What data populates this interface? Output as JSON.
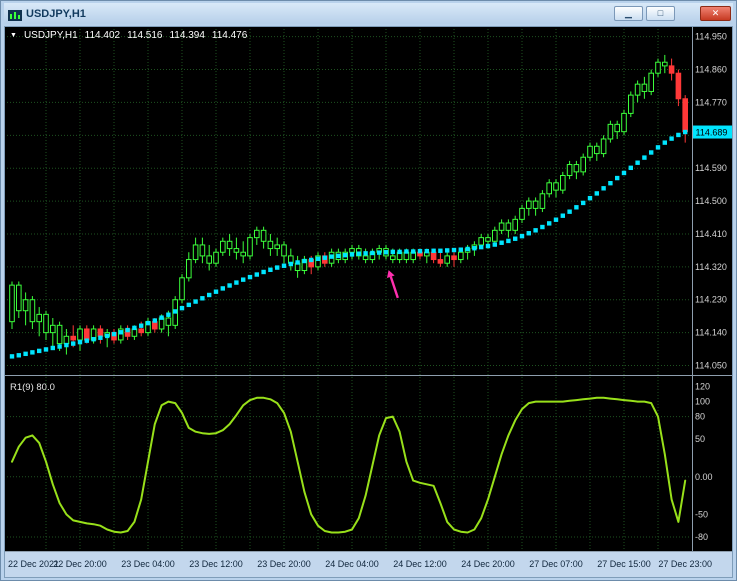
{
  "window": {
    "title": "USDJPY,H1"
  },
  "icons": {
    "dropdown": "▼",
    "minimize": "▁",
    "maximize": "□",
    "close": "✕"
  },
  "header": {
    "symbol_period": "USDJPY,H1",
    "open": "114.402",
    "high": "114.516",
    "low": "114.394",
    "close": "114.476"
  },
  "indicator": {
    "label": "R1(9) 80.0"
  },
  "colors": {
    "chart_bg": "#000000",
    "grid": "#1e5220",
    "candle_up": "#3bff3b",
    "candle_down": "#ff3838",
    "trend": "#00e5ff",
    "oscillator": "#98e01a",
    "separator": "#8e9eae",
    "axis_text": "#d4d4d4",
    "tag_bg": "#00e5ff",
    "tag_text": "#000000",
    "time_strip_bg": "#c3d7ed",
    "time_text": "#10263c",
    "arrow": "#ff2fae"
  },
  "chart_data": {
    "type": "candlestick",
    "title": "USDJPY H1",
    "price_axis": {
      "min": 114.035,
      "max": 114.96,
      "tick_step": 0.09,
      "labels": [
        "114.950",
        "114.860",
        "114.770",
        "114.680",
        "114.590",
        "114.500",
        "114.410",
        "114.320",
        "114.230",
        "114.140",
        "114.050"
      ],
      "current_price": 114.689,
      "current_price_label": "114.689"
    },
    "time_axis": {
      "labels": [
        "22 Dec 2021",
        "22 Dec 20:00",
        "23 Dec 04:00",
        "23 Dec 12:00",
        "23 Dec 20:00",
        "24 Dec 04:00",
        "24 Dec 12:00",
        "24 Dec 20:00",
        "27 Dec 07:00",
        "27 Dec 15:00",
        "27 Dec 23:00"
      ],
      "bar_indices": [
        0,
        10,
        20,
        30,
        40,
        50,
        60,
        70,
        80,
        90,
        99
      ]
    },
    "grid_v_every_bars": 5,
    "candles": [
      [
        114.17,
        114.28,
        114.15,
        114.27,
        "g"
      ],
      [
        114.27,
        114.28,
        114.18,
        114.2,
        "g"
      ],
      [
        114.2,
        114.25,
        114.16,
        114.23,
        "g"
      ],
      [
        114.23,
        114.24,
        114.15,
        114.17,
        "g"
      ],
      [
        114.17,
        114.21,
        114.13,
        114.19,
        "g"
      ],
      [
        114.19,
        114.2,
        114.12,
        114.14,
        "g"
      ],
      [
        114.14,
        114.18,
        114.1,
        114.16,
        "g"
      ],
      [
        114.16,
        114.17,
        114.09,
        114.11,
        "g"
      ],
      [
        114.11,
        114.15,
        114.08,
        114.13,
        "g"
      ],
      [
        114.13,
        114.16,
        114.1,
        114.12,
        "r"
      ],
      [
        114.12,
        114.16,
        114.09,
        114.15,
        "g"
      ],
      [
        114.15,
        114.16,
        114.11,
        114.12,
        "r"
      ],
      [
        114.12,
        114.16,
        114.11,
        114.15,
        "g"
      ],
      [
        114.15,
        114.16,
        114.11,
        114.13,
        "r"
      ],
      [
        114.13,
        114.15,
        114.1,
        114.14,
        "g"
      ],
      [
        114.14,
        114.15,
        114.11,
        114.12,
        "r"
      ],
      [
        114.12,
        114.16,
        114.11,
        114.15,
        "g"
      ],
      [
        114.15,
        114.16,
        114.12,
        114.13,
        "r"
      ],
      [
        114.13,
        114.16,
        114.12,
        114.15,
        "g"
      ],
      [
        114.15,
        114.17,
        114.13,
        114.14,
        "r"
      ],
      [
        114.14,
        114.18,
        114.13,
        114.17,
        "g"
      ],
      [
        114.17,
        114.18,
        114.14,
        114.15,
        "r"
      ],
      [
        114.15,
        114.19,
        114.14,
        114.18,
        "g"
      ],
      [
        114.18,
        114.2,
        114.13,
        114.16,
        "g"
      ],
      [
        114.16,
        114.24,
        114.15,
        114.23,
        "g"
      ],
      [
        114.23,
        114.3,
        114.22,
        114.29,
        "g"
      ],
      [
        114.29,
        114.36,
        114.28,
        114.34,
        "g"
      ],
      [
        114.34,
        114.4,
        114.33,
        114.38,
        "g"
      ],
      [
        114.38,
        114.4,
        114.33,
        114.35,
        "g"
      ],
      [
        114.35,
        114.38,
        114.31,
        114.33,
        "g"
      ],
      [
        114.33,
        114.37,
        114.32,
        114.36,
        "g"
      ],
      [
        114.36,
        114.4,
        114.35,
        114.39,
        "g"
      ],
      [
        114.39,
        114.41,
        114.35,
        114.37,
        "g"
      ],
      [
        114.37,
        114.4,
        114.34,
        114.36,
        "g"
      ],
      [
        114.36,
        114.39,
        114.33,
        114.35,
        "g"
      ],
      [
        114.35,
        114.41,
        114.34,
        114.4,
        "g"
      ],
      [
        114.4,
        114.43,
        114.38,
        114.42,
        "g"
      ],
      [
        114.42,
        114.43,
        114.37,
        114.39,
        "g"
      ],
      [
        114.39,
        114.41,
        114.35,
        114.37,
        "g"
      ],
      [
        114.37,
        114.4,
        114.35,
        114.38,
        "g"
      ],
      [
        114.38,
        114.39,
        114.33,
        114.35,
        "g"
      ],
      [
        114.35,
        114.37,
        114.31,
        114.33,
        "g"
      ],
      [
        114.33,
        114.35,
        114.29,
        114.31,
        "g"
      ],
      [
        114.31,
        114.35,
        114.3,
        114.34,
        "g"
      ],
      [
        114.34,
        114.35,
        114.3,
        114.32,
        "r"
      ],
      [
        114.32,
        114.36,
        114.31,
        114.35,
        "g"
      ],
      [
        114.35,
        114.36,
        114.32,
        114.33,
        "r"
      ],
      [
        114.33,
        114.37,
        114.32,
        114.36,
        "g"
      ],
      [
        114.36,
        114.37,
        114.33,
        114.34,
        "g"
      ],
      [
        114.34,
        114.37,
        114.33,
        114.36,
        "g"
      ],
      [
        114.36,
        114.38,
        114.34,
        114.37,
        "g"
      ],
      [
        114.37,
        114.38,
        114.34,
        114.35,
        "g"
      ],
      [
        114.35,
        114.37,
        114.33,
        114.34,
        "g"
      ],
      [
        114.34,
        114.37,
        114.33,
        114.36,
        "g"
      ],
      [
        114.36,
        114.38,
        114.34,
        114.37,
        "g"
      ],
      [
        114.37,
        114.38,
        114.34,
        114.35,
        "g"
      ],
      [
        114.35,
        114.37,
        114.33,
        114.34,
        "g"
      ],
      [
        114.34,
        114.37,
        114.33,
        114.36,
        "g"
      ],
      [
        114.36,
        114.37,
        114.33,
        114.34,
        "g"
      ],
      [
        114.34,
        114.37,
        114.33,
        114.36,
        "g"
      ],
      [
        114.36,
        114.37,
        114.34,
        114.35,
        "r"
      ],
      [
        114.35,
        114.37,
        114.33,
        114.36,
        "g"
      ],
      [
        114.36,
        114.37,
        114.33,
        114.34,
        "r"
      ],
      [
        114.34,
        114.36,
        114.32,
        114.33,
        "r"
      ],
      [
        114.33,
        114.36,
        114.32,
        114.35,
        "g"
      ],
      [
        114.35,
        114.36,
        114.32,
        114.34,
        "r"
      ],
      [
        114.34,
        114.37,
        114.33,
        114.36,
        "g"
      ],
      [
        114.36,
        114.38,
        114.34,
        114.37,
        "g"
      ],
      [
        114.37,
        114.39,
        114.35,
        114.38,
        "g"
      ],
      [
        114.38,
        114.41,
        114.37,
        114.4,
        "g"
      ],
      [
        114.4,
        114.41,
        114.37,
        114.39,
        "g"
      ],
      [
        114.39,
        114.43,
        114.38,
        114.42,
        "g"
      ],
      [
        114.42,
        114.45,
        114.41,
        114.44,
        "g"
      ],
      [
        114.44,
        114.45,
        114.4,
        114.42,
        "g"
      ],
      [
        114.42,
        114.46,
        114.41,
        114.45,
        "g"
      ],
      [
        114.45,
        114.49,
        114.44,
        114.48,
        "g"
      ],
      [
        114.48,
        114.51,
        114.46,
        114.5,
        "g"
      ],
      [
        114.5,
        114.51,
        114.46,
        114.48,
        "g"
      ],
      [
        114.48,
        114.53,
        114.47,
        114.52,
        "g"
      ],
      [
        114.52,
        114.56,
        114.51,
        114.55,
        "g"
      ],
      [
        114.55,
        114.56,
        114.51,
        114.53,
        "g"
      ],
      [
        114.53,
        114.58,
        114.52,
        114.57,
        "g"
      ],
      [
        114.57,
        114.61,
        114.56,
        114.6,
        "g"
      ],
      [
        114.6,
        114.61,
        114.56,
        114.58,
        "g"
      ],
      [
        114.58,
        114.63,
        114.57,
        114.62,
        "g"
      ],
      [
        114.62,
        114.66,
        114.61,
        114.65,
        "g"
      ],
      [
        114.65,
        114.66,
        114.61,
        114.63,
        "g"
      ],
      [
        114.63,
        114.68,
        114.62,
        114.67,
        "g"
      ],
      [
        114.67,
        114.72,
        114.66,
        114.71,
        "g"
      ],
      [
        114.71,
        114.72,
        114.67,
        114.69,
        "g"
      ],
      [
        114.69,
        114.75,
        114.68,
        114.74,
        "g"
      ],
      [
        114.74,
        114.8,
        114.73,
        114.79,
        "g"
      ],
      [
        114.79,
        114.83,
        114.77,
        114.82,
        "g"
      ],
      [
        114.82,
        114.84,
        114.78,
        114.8,
        "g"
      ],
      [
        114.8,
        114.86,
        114.79,
        114.85,
        "g"
      ],
      [
        114.85,
        114.89,
        114.84,
        114.88,
        "g"
      ],
      [
        114.88,
        114.9,
        114.85,
        114.87,
        "g"
      ],
      [
        114.87,
        114.89,
        114.83,
        114.85,
        "r"
      ],
      [
        114.85,
        114.86,
        114.76,
        114.78,
        "r"
      ],
      [
        114.78,
        114.79,
        114.66,
        114.69,
        "r"
      ]
    ],
    "trend_dots": {
      "name": "trend-dots",
      "values": [
        114.075,
        114.078,
        114.082,
        114.086,
        114.09,
        114.094,
        114.098,
        114.102,
        114.106,
        114.11,
        114.114,
        114.118,
        114.122,
        114.126,
        114.131,
        114.136,
        114.141,
        114.147,
        114.153,
        114.159,
        114.166,
        114.173,
        114.181,
        114.189,
        114.198,
        114.207,
        114.216,
        114.225,
        114.234,
        114.243,
        114.252,
        114.261,
        114.269,
        114.277,
        114.285,
        114.292,
        114.299,
        114.306,
        114.312,
        114.318,
        114.323,
        114.328,
        114.332,
        114.336,
        114.339,
        114.342,
        114.345,
        114.348,
        114.35,
        114.352,
        114.354,
        114.356,
        114.357,
        114.358,
        114.359,
        114.36,
        114.361,
        114.361,
        114.362,
        114.362,
        114.363,
        114.363,
        114.364,
        114.364,
        114.365,
        114.366,
        114.367,
        114.369,
        114.371,
        114.374,
        114.377,
        114.381,
        114.386,
        114.391,
        114.397,
        114.404,
        114.412,
        114.42,
        114.429,
        114.439,
        114.449,
        114.46,
        114.471,
        114.483,
        114.495,
        114.508,
        114.521,
        114.535,
        114.549,
        114.563,
        114.577,
        114.591,
        114.605,
        114.619,
        114.633,
        114.647,
        114.66,
        114.671,
        114.681,
        114.689
      ]
    },
    "oscillator": {
      "name": "R1(9)",
      "axis_min": -92,
      "axis_max": 130,
      "axis_labels": [
        [
          120,
          "120"
        ],
        [
          100,
          "100"
        ],
        [
          80,
          "80"
        ],
        [
          50,
          "50"
        ],
        [
          0,
          "0.00"
        ],
        [
          -50,
          "-50"
        ],
        [
          -80,
          "-80"
        ]
      ],
      "levels": [
        80,
        0,
        -80
      ],
      "values": [
        20,
        40,
        52,
        55,
        45,
        20,
        -10,
        -35,
        -50,
        -58,
        -60,
        -62,
        -63,
        -65,
        -70,
        -73,
        -74,
        -72,
        -60,
        -30,
        20,
        70,
        95,
        100,
        98,
        85,
        65,
        60,
        58,
        57,
        58,
        62,
        70,
        82,
        95,
        102,
        105,
        105,
        103,
        98,
        85,
        60,
        20,
        -20,
        -50,
        -65,
        -72,
        -74,
        -74,
        -73,
        -70,
        -55,
        -25,
        15,
        55,
        78,
        80,
        60,
        20,
        -5,
        -8,
        -10,
        -12,
        -35,
        -60,
        -70,
        -73,
        -74,
        -70,
        -55,
        -30,
        0,
        30,
        55,
        75,
        90,
        98,
        100,
        100,
        100,
        100,
        100,
        101,
        102,
        103,
        104,
        105,
        105,
        104,
        103,
        102,
        101,
        100,
        100,
        98,
        80,
        30,
        -30,
        -60,
        -5
      ]
    },
    "arrow": {
      "bar": 56,
      "price_tip": 114.312,
      "price_tail": 114.235
    }
  }
}
